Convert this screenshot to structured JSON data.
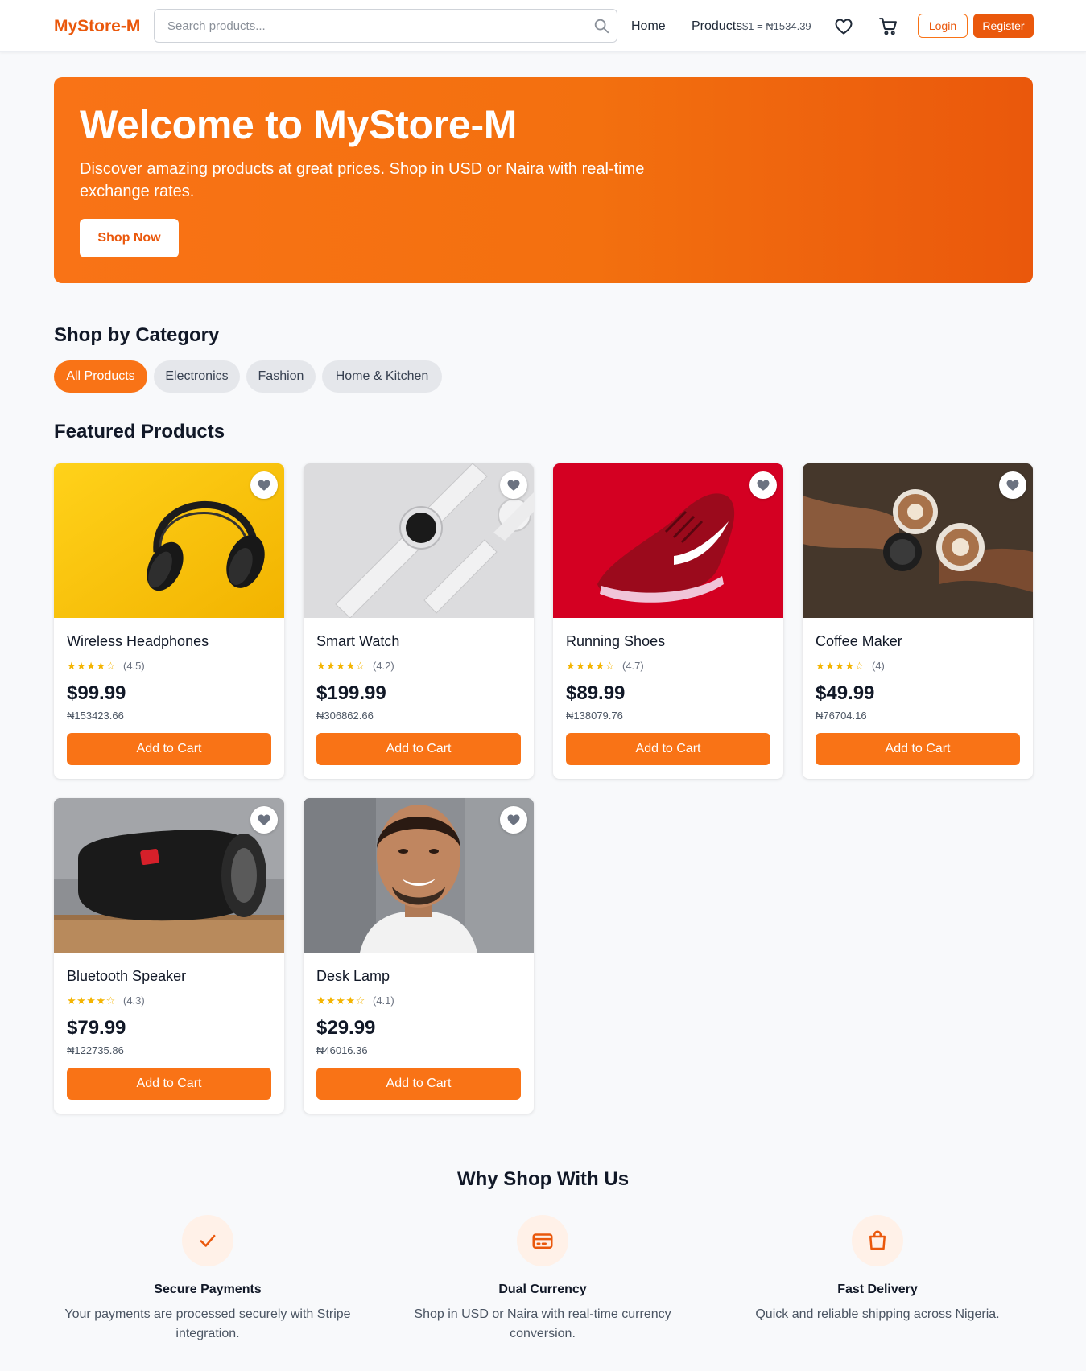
{
  "header": {
    "brand": "MyStore-M",
    "search_placeholder": "Search products...",
    "nav": {
      "home": "Home",
      "products": "Products"
    },
    "exchange_rate": "$1 = ₦1534.39",
    "login": "Login",
    "register": "Register"
  },
  "hero": {
    "title": "Welcome to MyStore-M",
    "subtitle": "Discover amazing products at great prices. Shop in USD or Naira with real-time exchange rates.",
    "cta": "Shop Now"
  },
  "categories": {
    "title": "Shop by Category",
    "items": [
      "All Products",
      "Electronics",
      "Fashion",
      "Home & Kitchen"
    ],
    "active": "All Products"
  },
  "featured": {
    "title": "Featured Products",
    "add_label": "Add to Cart",
    "products": [
      {
        "name": "Wireless Headphones",
        "rating": "(4.5)",
        "price_usd": "$99.99",
        "price_ngn": "₦153423.66",
        "stars": 4.5
      },
      {
        "name": "Smart Watch",
        "rating": "(4.2)",
        "price_usd": "$199.99",
        "price_ngn": "₦306862.66",
        "stars": 4.2
      },
      {
        "name": "Running Shoes",
        "rating": "(4.7)",
        "price_usd": "$89.99",
        "price_ngn": "₦138079.76",
        "stars": 4.7
      },
      {
        "name": "Coffee Maker",
        "rating": "(4)",
        "price_usd": "$49.99",
        "price_ngn": "₦76704.16",
        "stars": 4
      },
      {
        "name": "Bluetooth Speaker",
        "rating": "(4.3)",
        "price_usd": "$79.99",
        "price_ngn": "₦122735.86",
        "stars": 4.3
      },
      {
        "name": "Desk Lamp",
        "rating": "(4.1)",
        "price_usd": "$29.99",
        "price_ngn": "₦46016.36",
        "stars": 4.1
      }
    ]
  },
  "why": {
    "title": "Why Shop With Us",
    "features": [
      {
        "icon": "check-icon",
        "title": "Secure Payments",
        "desc": "Your payments are processed securely with Stripe integration."
      },
      {
        "icon": "credit-card-icon",
        "title": "Dual Currency",
        "desc": "Shop in USD or Naira with real-time currency conversion."
      },
      {
        "icon": "shopping-bag-icon",
        "title": "Fast Delivery",
        "desc": "Quick and reliable shipping across Nigeria."
      }
    ]
  },
  "colors": {
    "accent": "#f97316",
    "accent_dark": "#ea580c",
    "star": "#f4b400"
  }
}
